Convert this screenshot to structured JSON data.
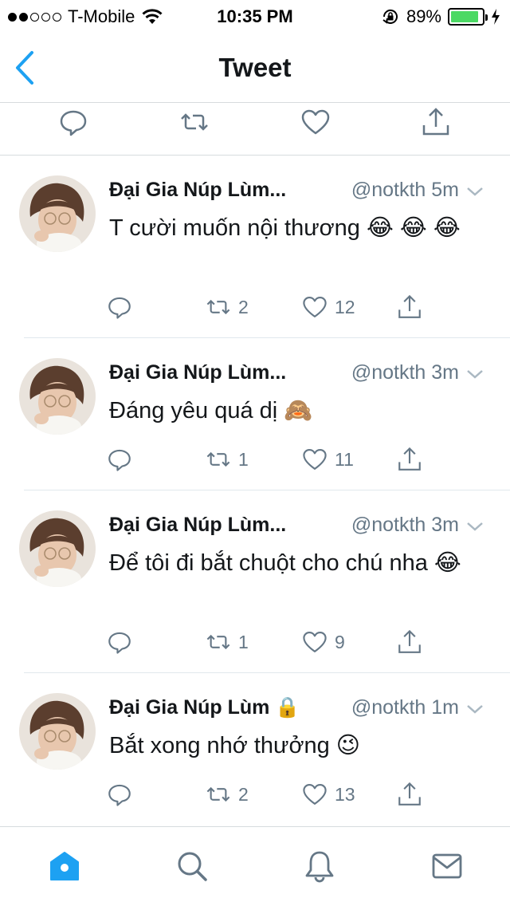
{
  "status": {
    "carrier": "T-Mobile",
    "time": "10:35 PM",
    "battery": "89%",
    "battery_level": 0.89
  },
  "nav": {
    "title": "Tweet",
    "back_icon": "chevron-left-icon"
  },
  "replies": [
    {
      "name": "Đại Gia Núp Lùm...",
      "handle_time": "@notkth 5m",
      "text": "T cười muốn nội thương 😂 😂 😂",
      "retweets": "2",
      "likes": "12"
    },
    {
      "name": "Đại Gia Núp Lùm...",
      "handle_time": "@notkth 3m",
      "text": "Đáng yêu quá dị 🙈",
      "retweets": "1",
      "likes": "11"
    },
    {
      "name": "Đại Gia Núp Lùm...",
      "handle_time": "@notkth 3m",
      "text": "Để tôi đi bắt chuột cho chú nha 😂",
      "retweets": "1",
      "likes": "9"
    },
    {
      "name": "Đại Gia Núp Lùm 🔒",
      "handle_time": "@notkth 1m",
      "text": "Bắt xong nhớ thưởng 😉",
      "retweets": "2",
      "likes": "13"
    }
  ],
  "colors": {
    "accent": "#1da1f2",
    "text": "#14171a",
    "secondary": "#657786",
    "battery": "#4cd964"
  }
}
